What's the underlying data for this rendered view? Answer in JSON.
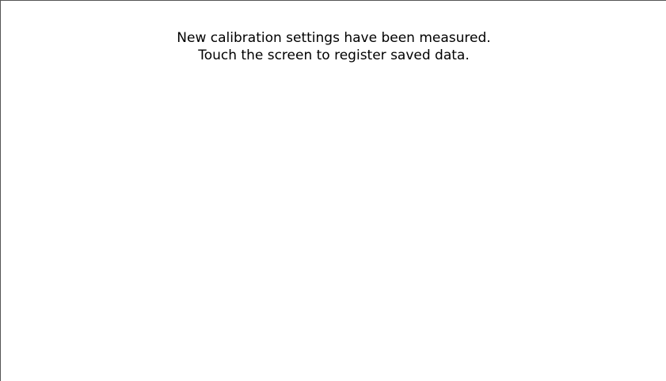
{
  "calibration": {
    "message_line_1": "New calibration settings have been measured.",
    "message_line_2": "Touch the screen to register saved data."
  }
}
